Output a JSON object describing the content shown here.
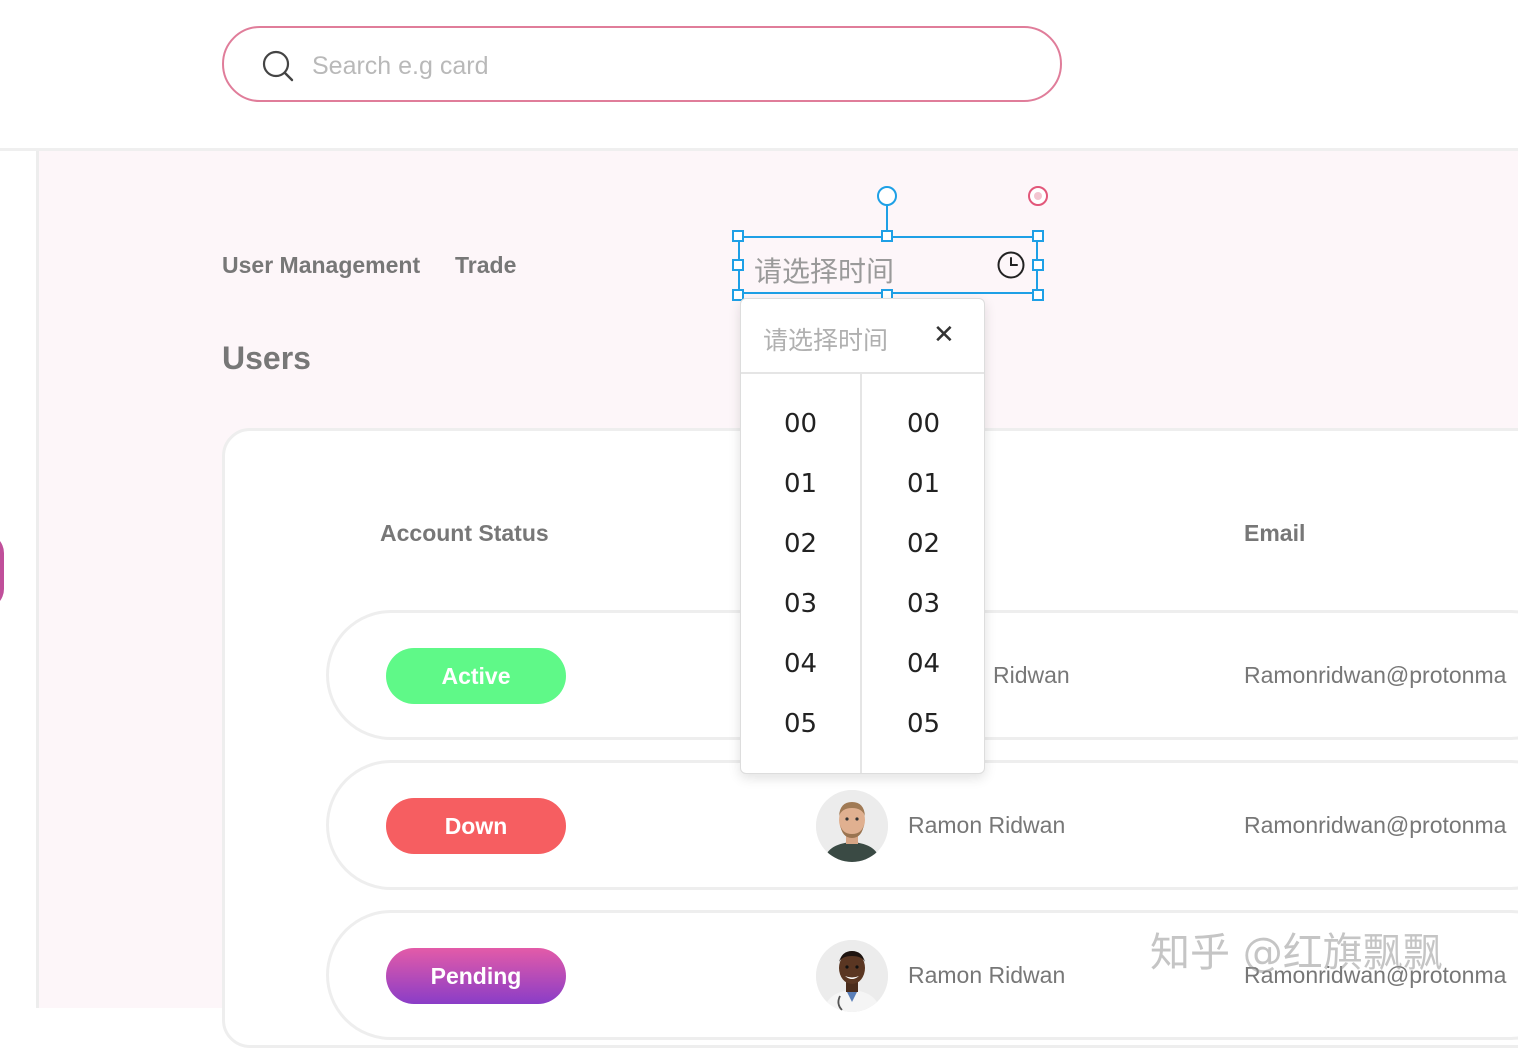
{
  "search": {
    "placeholder": "Search e.g card"
  },
  "nav": {
    "user_management": "User Management",
    "trade": "Trade"
  },
  "page": {
    "title": "Users"
  },
  "table": {
    "columns": {
      "status": "Account Status",
      "email": "Email"
    },
    "rows": [
      {
        "status": "Active",
        "name": "Ridwan",
        "email": "Ramonridwan@protonma"
      },
      {
        "status": "Down",
        "name": "Ramon Ridwan",
        "email": "Ramonridwan@protonma"
      },
      {
        "status": "Pending",
        "name": "Ramon Ridwan",
        "email": "Ramonridwan@protonma"
      }
    ]
  },
  "time_input": {
    "placeholder": "请选择时间"
  },
  "picker": {
    "placeholder": "请选择时间",
    "close": "✕",
    "hours": [
      "00",
      "01",
      "02",
      "03",
      "04",
      "05"
    ],
    "minutes": [
      "00",
      "01",
      "02",
      "03",
      "04",
      "05"
    ]
  },
  "watermark": "知乎 @红旗飘飘",
  "colors": {
    "accent_border": "#e07d9a",
    "active": "#5ff988",
    "down": "#f65e61",
    "pending_gradient": [
      "#e35ba8",
      "#8a3dc7"
    ],
    "selection": "#1ea0e6"
  }
}
